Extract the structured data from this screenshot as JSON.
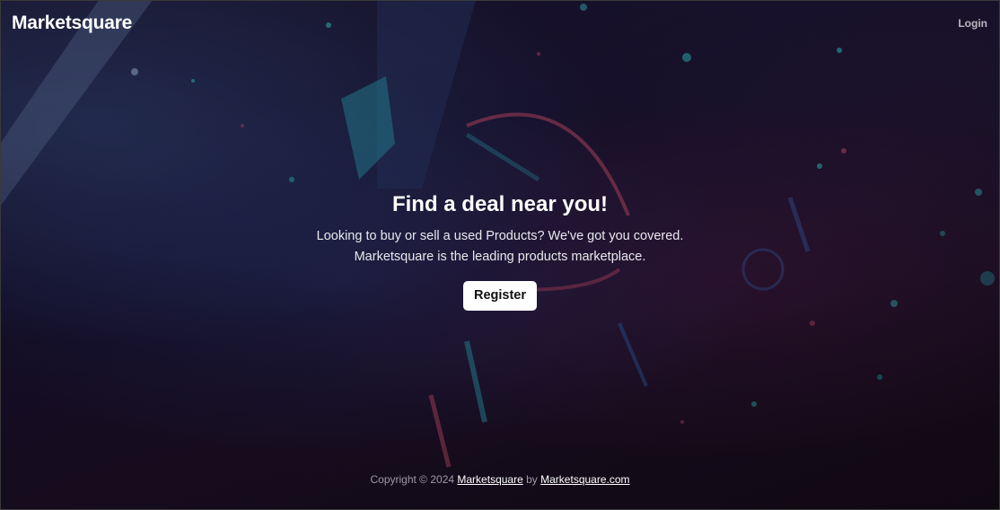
{
  "nav": {
    "brand": "Marketsquare",
    "login": "Login"
  },
  "hero": {
    "title": "Find a deal near you!",
    "line1": "Looking to buy or sell a used Products? We've got you covered.",
    "line2": "Marketsquare is the leading products marketplace.",
    "cta": "Register"
  },
  "footer": {
    "prefix": "Copyright © 2024",
    "brand_link": "Marketsquare",
    "by": "by",
    "site_link": "Marketsquare.com"
  }
}
